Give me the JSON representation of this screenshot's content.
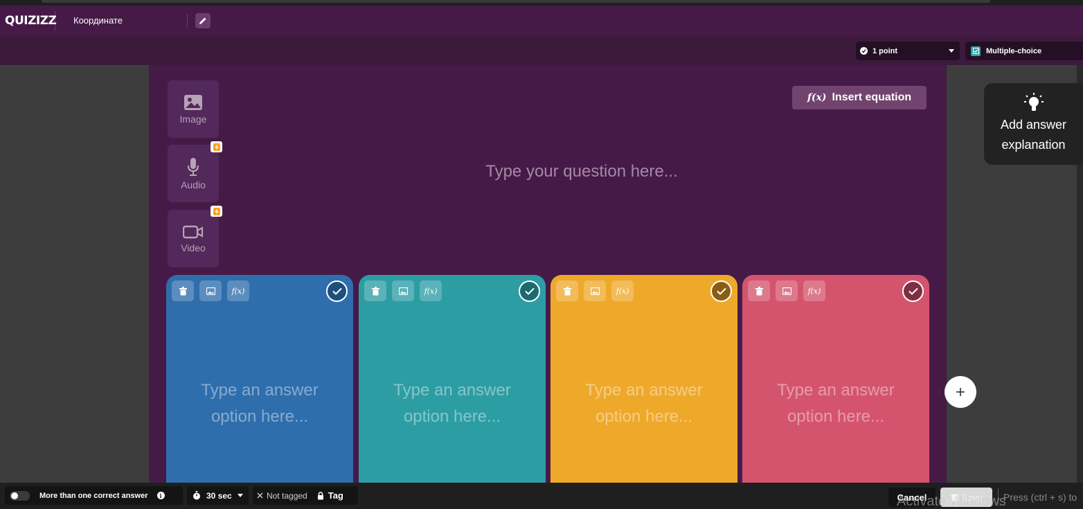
{
  "app": {
    "logo_text": "QUIZIZZ",
    "quiz_title": "Координате"
  },
  "toolbar": {
    "points_label": "1 point",
    "question_type_label": "Multiple-choice"
  },
  "media": {
    "image_label": "Image",
    "audio_label": "Audio",
    "video_label": "Video"
  },
  "editor": {
    "insert_equation_label": "Insert equation",
    "question_placeholder": "Type your question here..."
  },
  "answers": [
    {
      "placeholder": "Type an answer option here...",
      "color": "#2f6ead"
    },
    {
      "placeholder": "Type an answer option here...",
      "color": "#2d9da4"
    },
    {
      "placeholder": "Type an answer option here...",
      "color": "#eea92b"
    },
    {
      "placeholder": "Type an answer option here...",
      "color": "#d4546e"
    }
  ],
  "explanation": {
    "label_line1": "Add answer",
    "label_line2": "explanation"
  },
  "footer": {
    "multi_correct_label": "More than one correct answer",
    "timer_label": "30 sec",
    "not_tagged_label": "Not tagged",
    "tag_label": "Tag",
    "cancel_label": "Cancel",
    "save_label": "Save",
    "save_hint": "Press (ctrl + s) to"
  },
  "overlay": {
    "watermark": "Activate Windows"
  },
  "colors": {
    "header": "#461a47",
    "subheader": "#3b1a3c",
    "editor_bg": "#461a47",
    "media_bg": "#53285a"
  }
}
